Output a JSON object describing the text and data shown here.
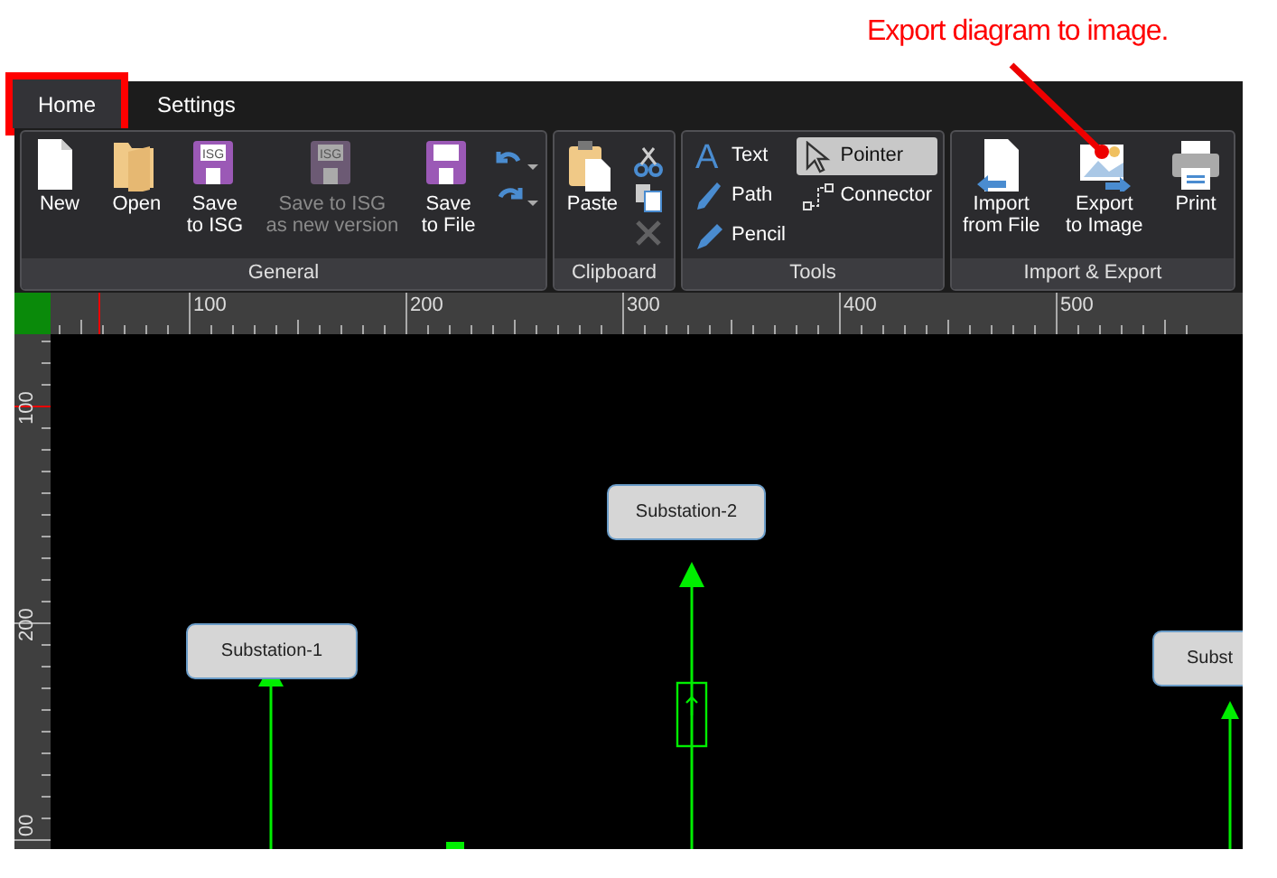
{
  "annotation": {
    "text": "Export diagram to image."
  },
  "tabs": [
    {
      "label": "Home",
      "selected": true,
      "highlighted": true
    },
    {
      "label": "Settings",
      "selected": false,
      "highlighted": false
    }
  ],
  "ribbon": {
    "groups": [
      {
        "title": "General",
        "buttons": [
          {
            "label": "New",
            "disabled": false
          },
          {
            "label": "Open",
            "disabled": false
          },
          {
            "label": "Save\nto ISG",
            "disabled": false,
            "icon_text": "ISG"
          },
          {
            "label": "Save to ISG\nas new version",
            "disabled": true,
            "icon_text": "ISG"
          },
          {
            "label": "Save\nto File",
            "disabled": false
          }
        ],
        "small_actions": [
          {
            "disabled": false
          },
          {
            "disabled": false
          }
        ]
      },
      {
        "title": "Clipboard",
        "buttons": [
          {
            "label": "Paste",
            "disabled": false
          }
        ],
        "small_actions": [
          {
            "disabled": false
          },
          {
            "disabled": false
          },
          {
            "disabled": true
          }
        ]
      },
      {
        "title": "Tools",
        "tools": [
          {
            "label": "Text",
            "selected": false,
            "icon_text": "A"
          },
          {
            "label": "Path",
            "selected": false
          },
          {
            "label": "Pencil",
            "selected": false
          },
          {
            "label": "Pointer",
            "selected": true
          },
          {
            "label": "Connector",
            "selected": false
          }
        ]
      },
      {
        "title": "Import & Export",
        "buttons": [
          {
            "label": "Import\nfrom File",
            "disabled": false
          },
          {
            "label": "Export\nto Image",
            "disabled": false
          },
          {
            "label": "Print",
            "disabled": false
          }
        ]
      }
    ]
  },
  "rulers": {
    "horizontal": [
      "100",
      "200",
      "300",
      "400",
      "500"
    ],
    "vertical": [
      "100",
      "200",
      "00"
    ]
  },
  "diagram": {
    "nodes": [
      {
        "label": "Substation-1"
      },
      {
        "label": "Substation-2"
      },
      {
        "label": "Subst"
      }
    ]
  }
}
